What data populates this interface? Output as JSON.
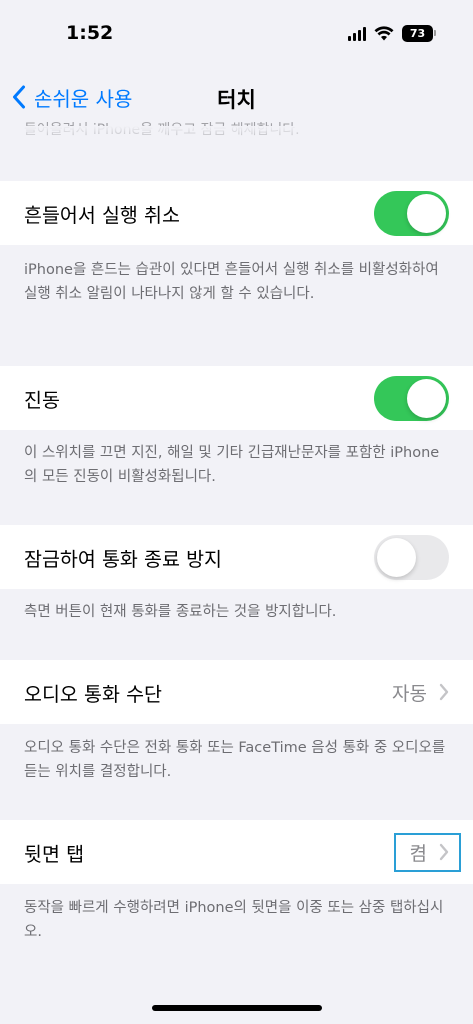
{
  "status": {
    "time": "1:52",
    "battery": "73"
  },
  "nav": {
    "back_label": "손쉬운 사용",
    "title": "터치"
  },
  "clipped_footer": "들어올려서 iPhone을 깨우고 잠금 해제합니다.",
  "rows": [
    {
      "label": "흔들어서 실행 취소",
      "toggle": "on",
      "footer": "iPhone을 흔드는 습관이 있다면 흔들어서 실행 취소를 비활성화하여 실행 취소 알림이 나타나지 않게 할 수 있습니다."
    },
    {
      "label": "진동",
      "toggle": "on",
      "footer": "이 스위치를 끄면 지진, 해일 및 기타 긴급재난문자를 포함한 iPhone의 모든 진동이 비활성화됩니다."
    },
    {
      "label": "잠금하여 통화 종료 방지",
      "toggle": "off",
      "footer": "측면 버튼이 현재 통화를 종료하는 것을 방지합니다."
    },
    {
      "label": "오디오 통화 수단",
      "value": "자동",
      "footer": "오디오 통화 수단은 전화 통화 또는 FaceTime 음성 통화 중 오디오를 듣는 위치를 결정합니다."
    },
    {
      "label": "뒷면 탭",
      "value": "켬",
      "footer": "동작을 빠르게 수행하려면 iPhone의 뒷면을 이중 또는 삼중 탭하십시오."
    }
  ],
  "colors": {
    "accent": "#007aff",
    "toggle_on": "#34c759",
    "highlight": "#2a9fd6"
  }
}
